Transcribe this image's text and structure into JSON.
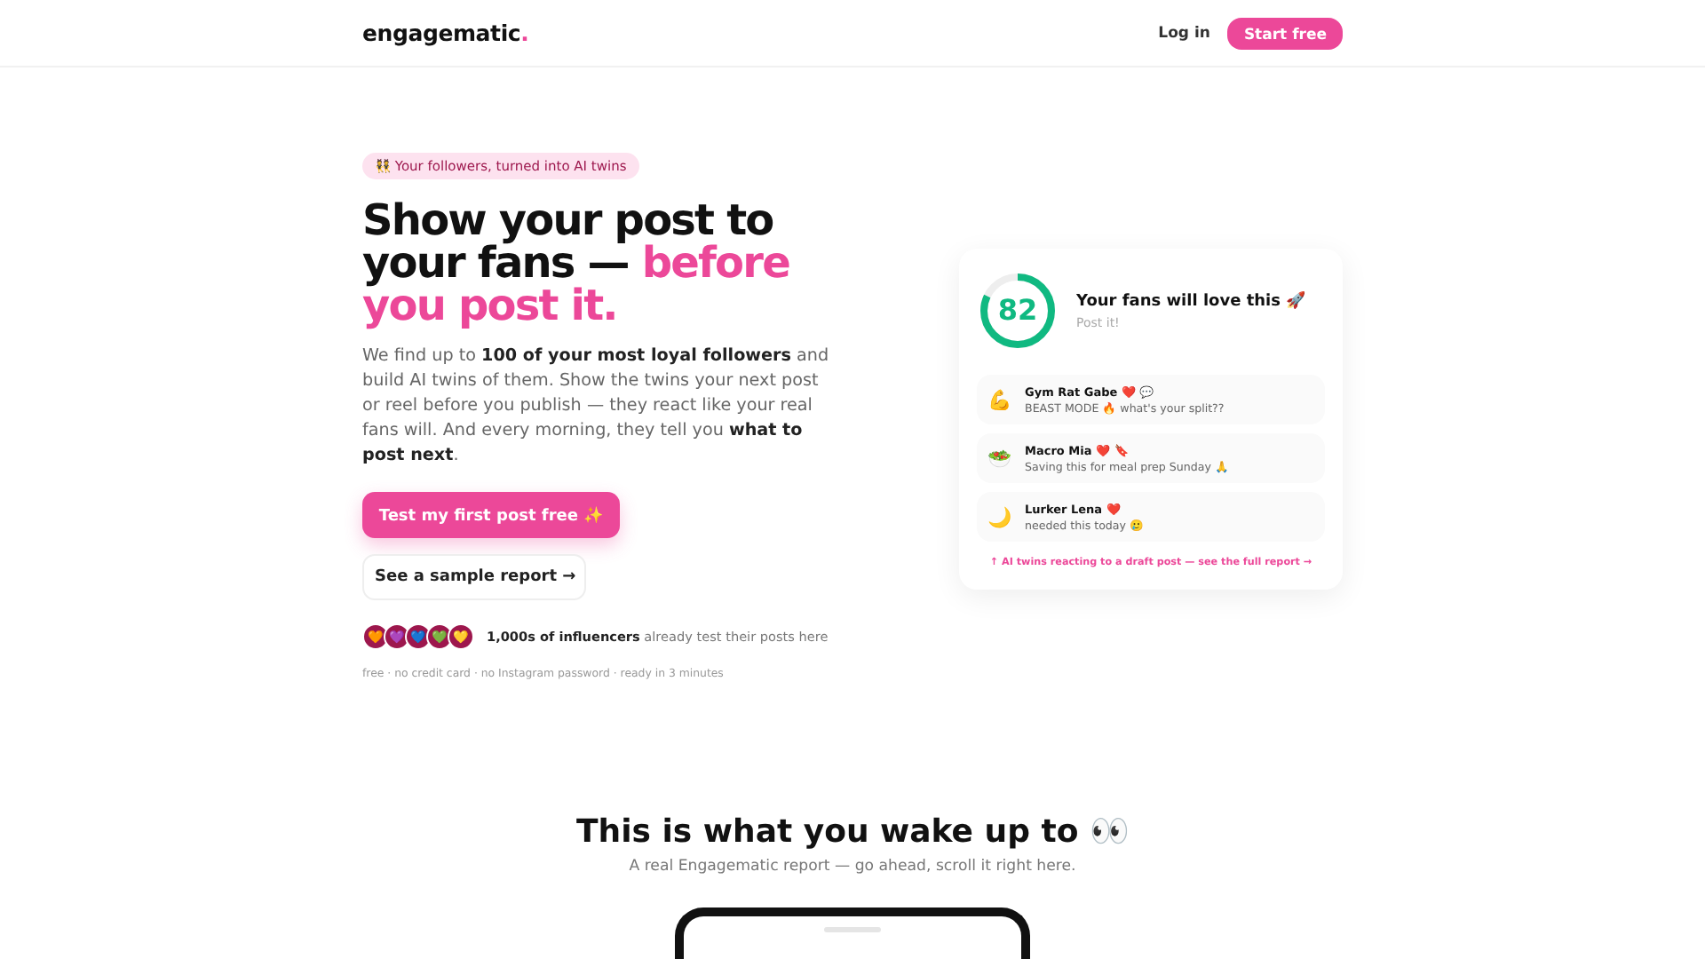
{
  "header": {
    "logo": "engagematic",
    "logo_dot": ".",
    "login": "Log in",
    "cta": "Start free"
  },
  "hero": {
    "badge": "👯 Your followers, turned into AI twins",
    "headline": "Show your post to your fans — ",
    "headline_accent": "before you post it.",
    "body": "We find up to **100 of your most loyal followers** and build AI twins of them. Show the twins your next post or reel before you publish — they react like your real fans will. And every morning, they tell you **what to post next**.",
    "primary_button": "Test my first post free ✨",
    "secondary_button": "See a sample report →",
    "avatars": [
      "🧡",
      "💜",
      "💙",
      "💚",
      "💛"
    ],
    "social_proof": "**1,000s of influencers** already test their posts here",
    "fine_print": "free · no credit card · no Instagram password · ready in 3 minutes"
  },
  "report_card": {
    "score": "82",
    "level": 0.82,
    "title": "Your fans will love this 🚀",
    "subtitle": "Post it!",
    "comments": [
      {
        "emoji": "💪",
        "name": "Gym Rat Gabe",
        "reactions": "❤️ 💬",
        "text": "BEAST MODE 🔥 what's your split??"
      },
      {
        "emoji": "🥗",
        "name": "Macro Mia",
        "reactions": "❤️ 🔖",
        "text": "Saving this for meal prep Sunday 🙏"
      },
      {
        "emoji": "🌙",
        "name": "Lurker Lena",
        "reactions": "❤️",
        "text": "needed this today 🥲"
      }
    ],
    "footer": "↑ AI twins reacting to a draft post — see the full report →"
  },
  "section": {
    "title": "This is what you wake up to 👀",
    "subtitle": "A real Engagematic report — go ahead, scroll it right here."
  }
}
